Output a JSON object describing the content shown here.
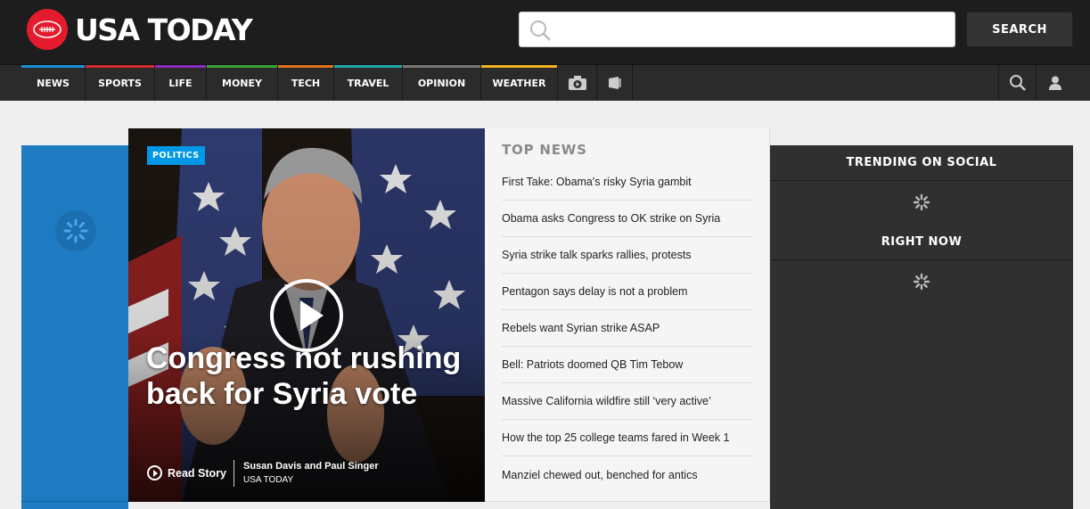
{
  "header": {
    "brand": "USA TODAY",
    "search_placeholder": "",
    "search_button": "SEARCH"
  },
  "nav": {
    "items": [
      {
        "label": "NEWS",
        "color": "#1a8fd6"
      },
      {
        "label": "SPORTS",
        "color": "#d62b2b"
      },
      {
        "label": "LIFE",
        "color": "#8c2dbf"
      },
      {
        "label": "MONEY",
        "color": "#3ba33b"
      },
      {
        "label": "TECH",
        "color": "#e0711b"
      },
      {
        "label": "TRAVEL",
        "color": "#1fa8a8"
      },
      {
        "label": "OPINION",
        "color": "#777777"
      },
      {
        "label": "WEATHER",
        "color": "#f0b41e"
      }
    ],
    "icons": [
      "camera-icon",
      "video-icon",
      "search-icon",
      "user-icon"
    ]
  },
  "hero": {
    "tag": "POLITICS",
    "headline": "Congress not rushing back for Syria vote",
    "read_story": "Read Story",
    "authors": "Susan Davis and Paul Singer",
    "outlet": "USA TODAY"
  },
  "top_news": {
    "title": "TOP NEWS",
    "items": [
      "First Take: Obama's risky Syria gambit",
      "Obama asks Congress to OK strike on Syria",
      "Syria strike talk sparks rallies, protests",
      "Pentagon says delay is not a problem",
      "Rebels want Syrian strike ASAP",
      "Bell: Patriots doomed QB Tim Tebow",
      "Massive California wildfire still ‘very active’",
      "How the top 25 college teams fared in Week 1",
      "Manziel chewed out, benched for antics"
    ]
  },
  "sidebar": {
    "trending": "TRENDING ON SOCIAL",
    "right_now": "RIGHT NOW"
  },
  "colors": {
    "brand_red": "#e41b2c",
    "politics_blue": "#0098e5",
    "left_rail_blue": "#1e7bc2"
  }
}
